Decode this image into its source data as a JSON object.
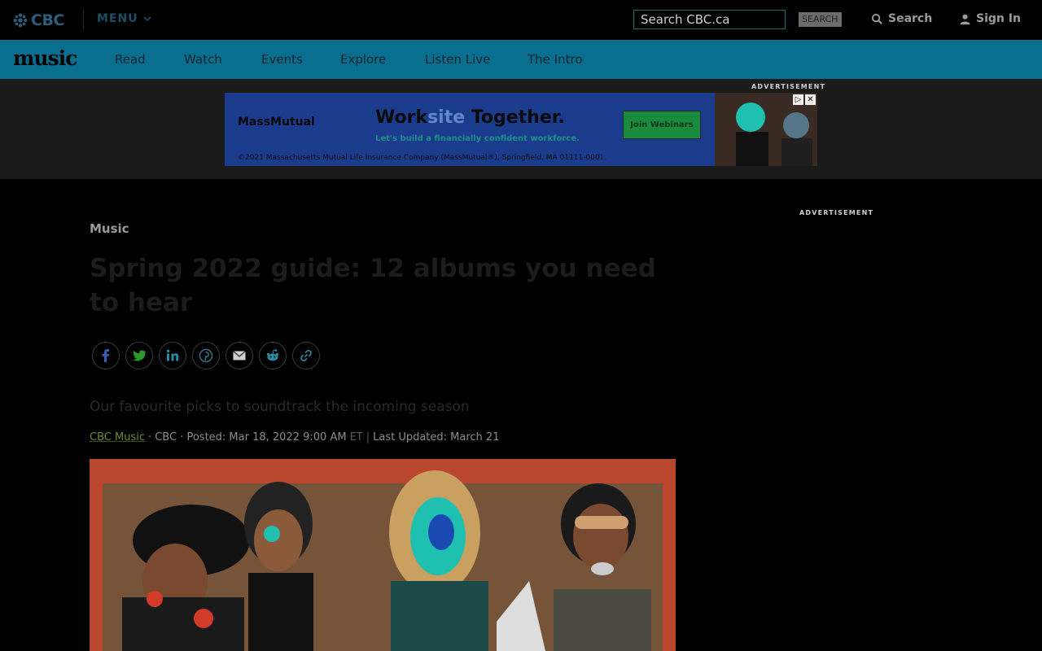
{
  "header": {
    "logo_text": "CBC",
    "menu_label": "MENU",
    "search_placeholder": "Search CBC.ca",
    "search_button": "SEARCH",
    "search_link": "Search",
    "sign_in": "Sign In"
  },
  "music_nav": {
    "brand": "music",
    "items": [
      "Read",
      "Watch",
      "Events",
      "Explore",
      "Listen Live",
      "The Intro"
    ]
  },
  "ad": {
    "label": "ADVERTISEMENT",
    "brand": "MassMutual",
    "headline_part1": "Work",
    "headline_accent": "site",
    "headline_part2": " Together.",
    "subline": "Let's build a financially confident workforce.",
    "cta": "Join Webinars",
    "legal": "©2021 Massachusetts Mutual Life Insurance Company (MassMutual®), Springfield, MA 01111-0001.",
    "choices_icon": "▷",
    "close_icon": "✕"
  },
  "sidebar": {
    "ad_label": "ADVERTISEMENT"
  },
  "article": {
    "section": "Music",
    "headline": "Spring 2022 guide: 12 albums you need to hear",
    "share_icons": [
      "facebook-icon",
      "twitter-icon",
      "linkedin-icon",
      "pinterest-icon",
      "email-icon",
      "reddit-icon",
      "link-icon"
    ],
    "deck": "Our favourite picks to soundtrack the incoming season",
    "author": "CBC Music",
    "source": "· CBC · Posted: Mar 18, 2022 9:00 AM",
    "tz": "ET",
    "sep": "|",
    "updated": "Last Updated: March 21"
  },
  "colors": {
    "nav_bg": "#0a6f8e",
    "ad_bg": "#1b3c8c",
    "hero_bg": "#b8472e"
  }
}
